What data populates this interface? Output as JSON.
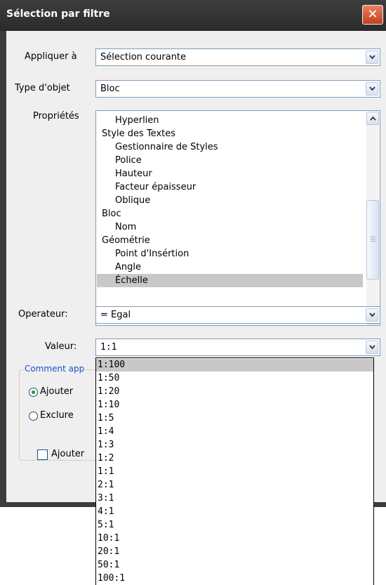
{
  "window": {
    "title": "Sélection par filtre",
    "close_glyph": "✕"
  },
  "form": {
    "apply_to": {
      "label": "Appliquer à",
      "value": "Sélection courante"
    },
    "object_type": {
      "label": "Type d'objet",
      "value": "Bloc"
    },
    "properties": {
      "label": "Propriétés",
      "items": [
        {
          "text": "Hyperlien",
          "indent": true
        },
        {
          "text": "Style des Textes",
          "indent": false
        },
        {
          "text": "Gestionnaire de Styles",
          "indent": true
        },
        {
          "text": "Police",
          "indent": true
        },
        {
          "text": "Hauteur",
          "indent": true
        },
        {
          "text": "Facteur épaisseur",
          "indent": true
        },
        {
          "text": "Oblique",
          "indent": true
        },
        {
          "text": "Bloc",
          "indent": false
        },
        {
          "text": "Nom",
          "indent": true
        },
        {
          "text": "Géométrie",
          "indent": false
        },
        {
          "text": "Point d'Insértion",
          "indent": true
        },
        {
          "text": "Angle",
          "indent": true
        },
        {
          "text": "Échelle",
          "indent": true,
          "selected": true
        }
      ]
    },
    "operator": {
      "label": "Operateur:",
      "value": "= Egal"
    },
    "value": {
      "label": "Valeur:",
      "input": "1:1"
    },
    "how_to_apply": {
      "label_visible": "Comment app",
      "include": "Ajouter",
      "exclude": "Exclure"
    },
    "add_checkbox_visible": "Ajouter"
  },
  "value_dropdown": {
    "options": [
      "1:100",
      "1:50",
      "1:20",
      "1:10",
      "1:5",
      "1:4",
      "1:3",
      "1:2",
      "1:1",
      "2:1",
      "3:1",
      "4:1",
      "5:1",
      "10:1",
      "20:1",
      "50:1",
      "100:1"
    ],
    "highlighted": "1:100"
  },
  "colors": {
    "titlebar": "#333333",
    "close": "#d9603f",
    "selection": "#c8c8c8",
    "group_label": "#1a4fd0",
    "radio_dot": "#21a121"
  },
  "icons": {
    "dropdown": "chevron-down-icon",
    "scroll_up": "chevron-up-icon",
    "scroll_down": "chevron-down-icon",
    "close": "close-icon"
  }
}
